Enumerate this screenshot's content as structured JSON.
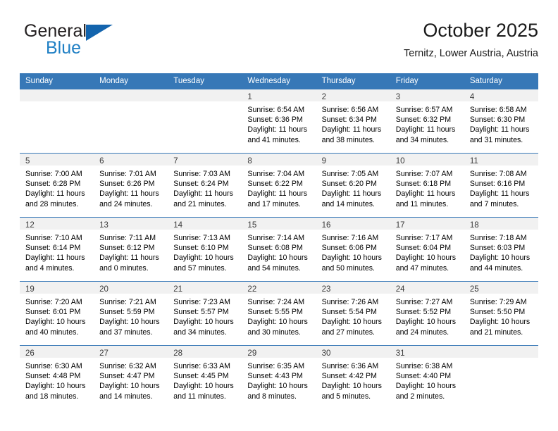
{
  "brand": {
    "word1": "General",
    "word2": "Blue",
    "triangle_color": "#1364ad",
    "blue_text_color": "#1f7fc4"
  },
  "header": {
    "month_title": "October 2025",
    "location": "Ternitz, Lower Austria, Austria",
    "header_bg_color": "#3778b7",
    "daynum_band_color": "#f1f1f1"
  },
  "weekday_headers": [
    "Sunday",
    "Monday",
    "Tuesday",
    "Wednesday",
    "Thursday",
    "Friday",
    "Saturday"
  ],
  "labels": {
    "sunrise_prefix": "Sunrise:",
    "sunset_prefix": "Sunset:",
    "daylight_prefix": "Daylight:"
  },
  "weeks": [
    [
      {
        "empty": true
      },
      {
        "empty": true
      },
      {
        "empty": true
      },
      {
        "day": "1",
        "sunrise": "Sunrise: 6:54 AM",
        "sunset": "Sunset: 6:36 PM",
        "daylight_l1": "Daylight: 11 hours",
        "daylight_l2": "and 41 minutes."
      },
      {
        "day": "2",
        "sunrise": "Sunrise: 6:56 AM",
        "sunset": "Sunset: 6:34 PM",
        "daylight_l1": "Daylight: 11 hours",
        "daylight_l2": "and 38 minutes."
      },
      {
        "day": "3",
        "sunrise": "Sunrise: 6:57 AM",
        "sunset": "Sunset: 6:32 PM",
        "daylight_l1": "Daylight: 11 hours",
        "daylight_l2": "and 34 minutes."
      },
      {
        "day": "4",
        "sunrise": "Sunrise: 6:58 AM",
        "sunset": "Sunset: 6:30 PM",
        "daylight_l1": "Daylight: 11 hours",
        "daylight_l2": "and 31 minutes."
      }
    ],
    [
      {
        "day": "5",
        "sunrise": "Sunrise: 7:00 AM",
        "sunset": "Sunset: 6:28 PM",
        "daylight_l1": "Daylight: 11 hours",
        "daylight_l2": "and 28 minutes."
      },
      {
        "day": "6",
        "sunrise": "Sunrise: 7:01 AM",
        "sunset": "Sunset: 6:26 PM",
        "daylight_l1": "Daylight: 11 hours",
        "daylight_l2": "and 24 minutes."
      },
      {
        "day": "7",
        "sunrise": "Sunrise: 7:03 AM",
        "sunset": "Sunset: 6:24 PM",
        "daylight_l1": "Daylight: 11 hours",
        "daylight_l2": "and 21 minutes."
      },
      {
        "day": "8",
        "sunrise": "Sunrise: 7:04 AM",
        "sunset": "Sunset: 6:22 PM",
        "daylight_l1": "Daylight: 11 hours",
        "daylight_l2": "and 17 minutes."
      },
      {
        "day": "9",
        "sunrise": "Sunrise: 7:05 AM",
        "sunset": "Sunset: 6:20 PM",
        "daylight_l1": "Daylight: 11 hours",
        "daylight_l2": "and 14 minutes."
      },
      {
        "day": "10",
        "sunrise": "Sunrise: 7:07 AM",
        "sunset": "Sunset: 6:18 PM",
        "daylight_l1": "Daylight: 11 hours",
        "daylight_l2": "and 11 minutes."
      },
      {
        "day": "11",
        "sunrise": "Sunrise: 7:08 AM",
        "sunset": "Sunset: 6:16 PM",
        "daylight_l1": "Daylight: 11 hours",
        "daylight_l2": "and 7 minutes."
      }
    ],
    [
      {
        "day": "12",
        "sunrise": "Sunrise: 7:10 AM",
        "sunset": "Sunset: 6:14 PM",
        "daylight_l1": "Daylight: 11 hours",
        "daylight_l2": "and 4 minutes."
      },
      {
        "day": "13",
        "sunrise": "Sunrise: 7:11 AM",
        "sunset": "Sunset: 6:12 PM",
        "daylight_l1": "Daylight: 11 hours",
        "daylight_l2": "and 0 minutes."
      },
      {
        "day": "14",
        "sunrise": "Sunrise: 7:13 AM",
        "sunset": "Sunset: 6:10 PM",
        "daylight_l1": "Daylight: 10 hours",
        "daylight_l2": "and 57 minutes."
      },
      {
        "day": "15",
        "sunrise": "Sunrise: 7:14 AM",
        "sunset": "Sunset: 6:08 PM",
        "daylight_l1": "Daylight: 10 hours",
        "daylight_l2": "and 54 minutes."
      },
      {
        "day": "16",
        "sunrise": "Sunrise: 7:16 AM",
        "sunset": "Sunset: 6:06 PM",
        "daylight_l1": "Daylight: 10 hours",
        "daylight_l2": "and 50 minutes."
      },
      {
        "day": "17",
        "sunrise": "Sunrise: 7:17 AM",
        "sunset": "Sunset: 6:04 PM",
        "daylight_l1": "Daylight: 10 hours",
        "daylight_l2": "and 47 minutes."
      },
      {
        "day": "18",
        "sunrise": "Sunrise: 7:18 AM",
        "sunset": "Sunset: 6:03 PM",
        "daylight_l1": "Daylight: 10 hours",
        "daylight_l2": "and 44 minutes."
      }
    ],
    [
      {
        "day": "19",
        "sunrise": "Sunrise: 7:20 AM",
        "sunset": "Sunset: 6:01 PM",
        "daylight_l1": "Daylight: 10 hours",
        "daylight_l2": "and 40 minutes."
      },
      {
        "day": "20",
        "sunrise": "Sunrise: 7:21 AM",
        "sunset": "Sunset: 5:59 PM",
        "daylight_l1": "Daylight: 10 hours",
        "daylight_l2": "and 37 minutes."
      },
      {
        "day": "21",
        "sunrise": "Sunrise: 7:23 AM",
        "sunset": "Sunset: 5:57 PM",
        "daylight_l1": "Daylight: 10 hours",
        "daylight_l2": "and 34 minutes."
      },
      {
        "day": "22",
        "sunrise": "Sunrise: 7:24 AM",
        "sunset": "Sunset: 5:55 PM",
        "daylight_l1": "Daylight: 10 hours",
        "daylight_l2": "and 30 minutes."
      },
      {
        "day": "23",
        "sunrise": "Sunrise: 7:26 AM",
        "sunset": "Sunset: 5:54 PM",
        "daylight_l1": "Daylight: 10 hours",
        "daylight_l2": "and 27 minutes."
      },
      {
        "day": "24",
        "sunrise": "Sunrise: 7:27 AM",
        "sunset": "Sunset: 5:52 PM",
        "daylight_l1": "Daylight: 10 hours",
        "daylight_l2": "and 24 minutes."
      },
      {
        "day": "25",
        "sunrise": "Sunrise: 7:29 AM",
        "sunset": "Sunset: 5:50 PM",
        "daylight_l1": "Daylight: 10 hours",
        "daylight_l2": "and 21 minutes."
      }
    ],
    [
      {
        "day": "26",
        "sunrise": "Sunrise: 6:30 AM",
        "sunset": "Sunset: 4:48 PM",
        "daylight_l1": "Daylight: 10 hours",
        "daylight_l2": "and 18 minutes."
      },
      {
        "day": "27",
        "sunrise": "Sunrise: 6:32 AM",
        "sunset": "Sunset: 4:47 PM",
        "daylight_l1": "Daylight: 10 hours",
        "daylight_l2": "and 14 minutes."
      },
      {
        "day": "28",
        "sunrise": "Sunrise: 6:33 AM",
        "sunset": "Sunset: 4:45 PM",
        "daylight_l1": "Daylight: 10 hours",
        "daylight_l2": "and 11 minutes."
      },
      {
        "day": "29",
        "sunrise": "Sunrise: 6:35 AM",
        "sunset": "Sunset: 4:43 PM",
        "daylight_l1": "Daylight: 10 hours",
        "daylight_l2": "and 8 minutes."
      },
      {
        "day": "30",
        "sunrise": "Sunrise: 6:36 AM",
        "sunset": "Sunset: 4:42 PM",
        "daylight_l1": "Daylight: 10 hours",
        "daylight_l2": "and 5 minutes."
      },
      {
        "day": "31",
        "sunrise": "Sunrise: 6:38 AM",
        "sunset": "Sunset: 4:40 PM",
        "daylight_l1": "Daylight: 10 hours",
        "daylight_l2": "and 2 minutes."
      },
      {
        "empty": true
      }
    ]
  ]
}
